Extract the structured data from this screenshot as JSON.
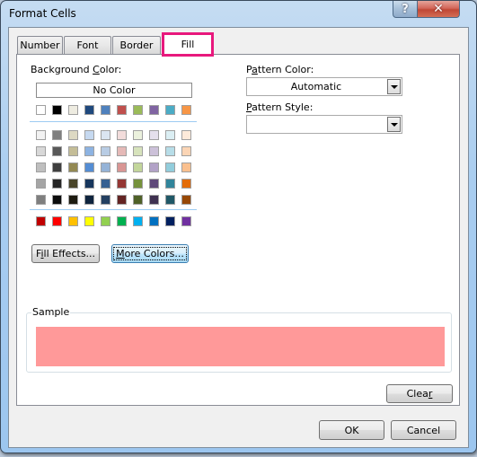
{
  "window": {
    "title": "Format Cells",
    "help_glyph": "?",
    "close_glyph": "✕"
  },
  "tabs": [
    {
      "label": "Number",
      "active": false
    },
    {
      "label": "Font",
      "active": false
    },
    {
      "label": "Border",
      "active": false
    },
    {
      "label": "Fill",
      "active": true
    }
  ],
  "highlight_color": "#e8197d",
  "background_color": {
    "label_pre": "Background ",
    "label_u": "C",
    "label_post": "olor:",
    "no_color_label": "No Color",
    "theme_row": [
      "#ffffff",
      "#000000",
      "#eeece1",
      "#1f497d",
      "#4f81bd",
      "#c0504d",
      "#9bbb59",
      "#8064a2",
      "#4bacc6",
      "#f79646"
    ],
    "tint_rows": [
      [
        "#f2f2f2",
        "#7f7f7f",
        "#ddd9c3",
        "#c6d9f0",
        "#dbe5f1",
        "#f2dcdb",
        "#ebf1dd",
        "#e5e0ec",
        "#dbeef3",
        "#fdeada"
      ],
      [
        "#d8d8d8",
        "#595959",
        "#c4bd97",
        "#8db3e2",
        "#b8cce4",
        "#e5b9b7",
        "#d7e3bc",
        "#ccc1d9",
        "#b7dde8",
        "#fbd5b5"
      ],
      [
        "#bfbfbf",
        "#3f3f3f",
        "#938953",
        "#548dd4",
        "#95b3d7",
        "#d99694",
        "#c3d69b",
        "#b2a2c7",
        "#92cddc",
        "#fac08f"
      ],
      [
        "#a5a5a5",
        "#262626",
        "#494429",
        "#17365d",
        "#366092",
        "#953734",
        "#76923c",
        "#5f497a",
        "#31859b",
        "#e36c09"
      ],
      [
        "#7f7f7f",
        "#0c0c0c",
        "#1d1b10",
        "#0f243e",
        "#244061",
        "#632423",
        "#4f6128",
        "#3f3151",
        "#205867",
        "#974806"
      ]
    ],
    "standard_row": [
      "#c00000",
      "#ff0000",
      "#ffc000",
      "#ffff00",
      "#92d050",
      "#00b050",
      "#00b0f0",
      "#0070c0",
      "#002060",
      "#7030a0"
    ]
  },
  "buttons": {
    "fill_effects": {
      "pre": "F",
      "u": "i",
      "post": "ll Effects..."
    },
    "more_colors": {
      "pre": "",
      "u": "M",
      "post": "ore Colors..."
    },
    "clear": {
      "pre": "Clea",
      "u": "r",
      "post": ""
    },
    "ok": "OK",
    "cancel": "Cancel"
  },
  "pattern_color": {
    "label_pre": "P",
    "label_u": "a",
    "label_post": "ttern Color:",
    "value": "Automatic"
  },
  "pattern_style": {
    "label_pre": "",
    "label_u": "P",
    "label_post": "attern Style:",
    "value": ""
  },
  "sample": {
    "label": "Sample",
    "color": "#ff9999"
  }
}
